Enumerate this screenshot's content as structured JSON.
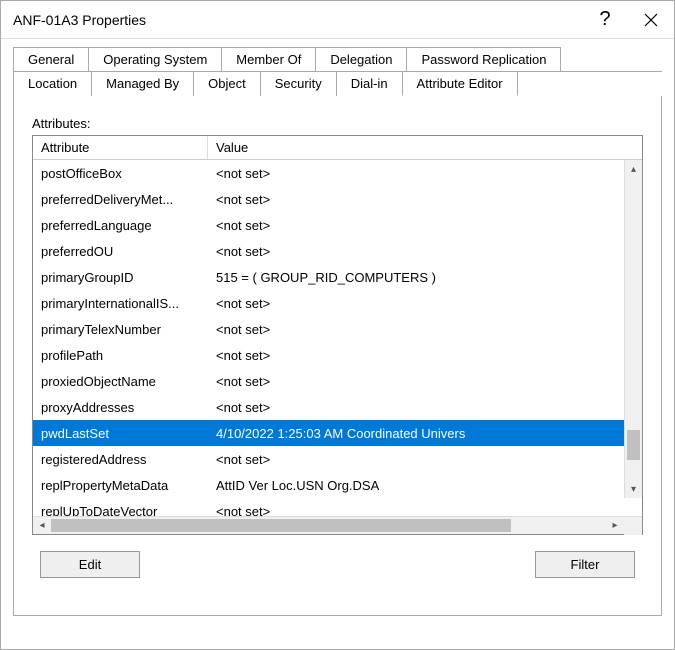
{
  "window": {
    "title": "ANF-01A3 Properties"
  },
  "tabs_row1": [
    {
      "label": "General"
    },
    {
      "label": "Operating System"
    },
    {
      "label": "Member Of"
    },
    {
      "label": "Delegation"
    },
    {
      "label": "Password Replication"
    }
  ],
  "tabs_row2": [
    {
      "label": "Location"
    },
    {
      "label": "Managed By"
    },
    {
      "label": "Object"
    },
    {
      "label": "Security"
    },
    {
      "label": "Dial-in"
    },
    {
      "label": "Attribute Editor",
      "active": true
    }
  ],
  "section_label": "Attributes:",
  "columns": {
    "attr": "Attribute",
    "val": "Value"
  },
  "rows": [
    {
      "attr": "postOfficeBox",
      "val": "<not set>"
    },
    {
      "attr": "preferredDeliveryMet...",
      "val": "<not set>"
    },
    {
      "attr": "preferredLanguage",
      "val": "<not set>"
    },
    {
      "attr": "preferredOU",
      "val": "<not set>"
    },
    {
      "attr": "primaryGroupID",
      "val": "515 = ( GROUP_RID_COMPUTERS )"
    },
    {
      "attr": "primaryInternationalIS...",
      "val": "<not set>"
    },
    {
      "attr": "primaryTelexNumber",
      "val": "<not set>"
    },
    {
      "attr": "profilePath",
      "val": "<not set>"
    },
    {
      "attr": "proxiedObjectName",
      "val": "<not set>"
    },
    {
      "attr": "proxyAddresses",
      "val": "<not set>"
    },
    {
      "attr": "pwdLastSet",
      "val": "4/10/2022 1:25:03 AM Coordinated Univers",
      "selected": true
    },
    {
      "attr": "registeredAddress",
      "val": "<not set>"
    },
    {
      "attr": "replPropertyMetaData",
      "val": " AttID  Ver      Loc.USN                 Org.DSA"
    },
    {
      "attr": "replUpToDateVector",
      "val": "<not set>"
    }
  ],
  "buttons": {
    "edit": "Edit",
    "filter": "Filter"
  }
}
